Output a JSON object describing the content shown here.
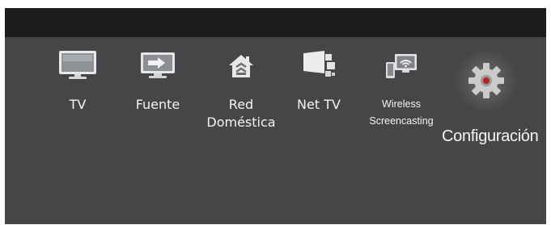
{
  "menu": {
    "items": [
      {
        "label": "TV",
        "icon": "tv-icon"
      },
      {
        "label": "Fuente",
        "icon": "source-input-icon"
      },
      {
        "label_line1": "Red",
        "label_line2": "Doméstica",
        "icon": "home-network-icon"
      },
      {
        "label": "Net TV",
        "icon": "net-tv-icon"
      },
      {
        "label_line1": "Wireless",
        "label_line2": "Screencasting",
        "icon": "wireless-screencasting-icon"
      },
      {
        "label": "Configuración",
        "icon": "gear-icon",
        "selected": true
      }
    ]
  },
  "colors": {
    "background": "#444648",
    "topbar": "#1e1b1c",
    "text": "#ffffff"
  }
}
